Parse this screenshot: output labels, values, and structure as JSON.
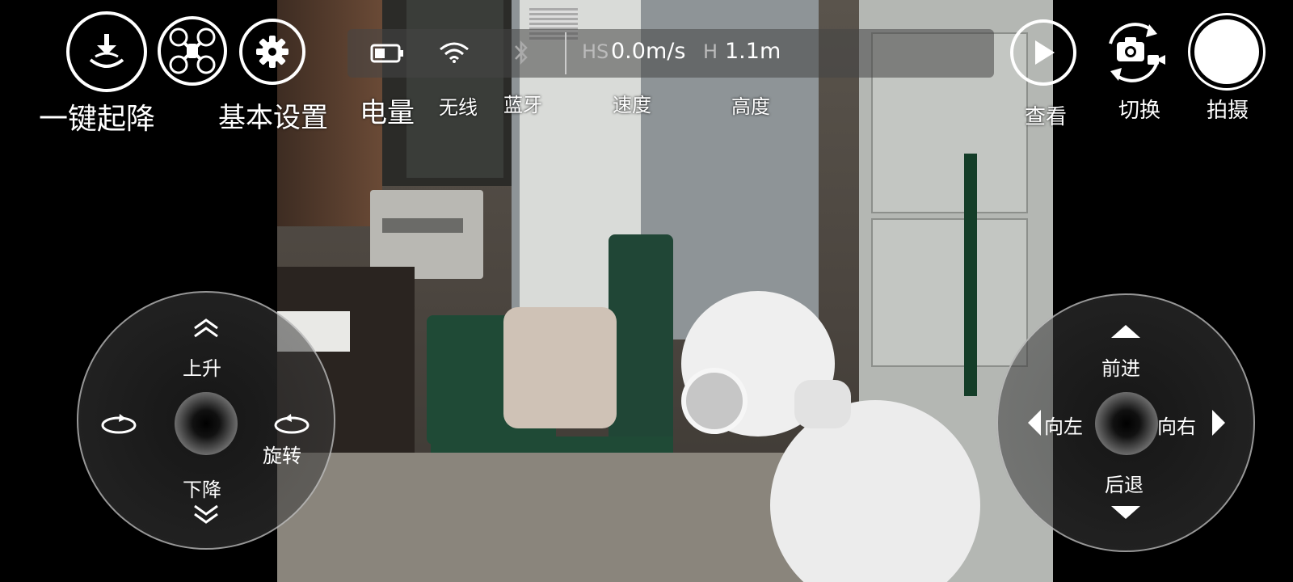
{
  "top_left": {
    "takeoff_land_label": "一键起降",
    "basic_settings_label": "基本设置"
  },
  "status": {
    "battery_label": "电量",
    "wifi_label": "无线",
    "bluetooth_label": "蓝牙",
    "speed_label": "速度",
    "height_label": "高度",
    "hs_prefix": "HS",
    "speed_value": "0.0m/s",
    "h_prefix": "H",
    "height_value": "1.1m"
  },
  "top_right": {
    "view_label": "查看",
    "switch_label": "切换",
    "capture_label": "拍摄"
  },
  "left_pad": {
    "up_label": "上升",
    "down_label": "下降",
    "rotate_label": "旋转"
  },
  "right_pad": {
    "forward_label": "前进",
    "back_label": "后退",
    "left_label": "向左",
    "right_label": "向右"
  },
  "icons": {
    "takeoff": "takeoff-land-icon",
    "drone": "drone-icon",
    "settings": "gear-icon",
    "battery": "battery-icon",
    "wifi": "wifi-icon",
    "bluetooth": "bluetooth-icon",
    "play": "play-icon",
    "switch": "camera-switch-icon",
    "shutter": "shutter-icon"
  }
}
